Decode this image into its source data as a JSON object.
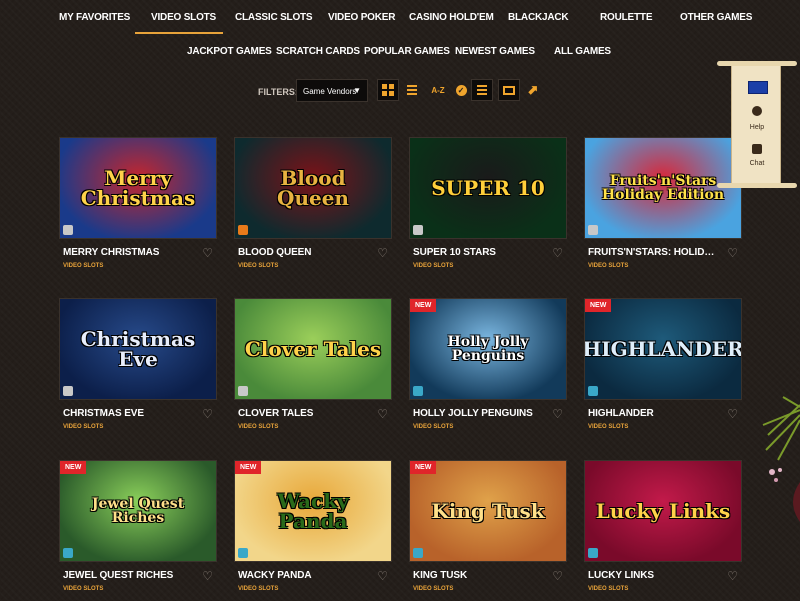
{
  "nav": {
    "main": [
      "MY FAVORITES",
      "VIDEO SLOTS",
      "CLASSIC SLOTS",
      "VIDEO POKER",
      "CASINO HOLD'EM",
      "BLACKJACK",
      "ROULETTE",
      "OTHER GAMES"
    ],
    "active": "VIDEO SLOTS",
    "sub": [
      "JACKPOT GAMES",
      "SCRATCH CARDS",
      "POPULAR GAMES",
      "NEWEST GAMES",
      "ALL GAMES"
    ]
  },
  "filters": {
    "label": "FILTERS:",
    "vendor_select": "Game Vendors",
    "sort_az": "A-Z"
  },
  "side_widget": {
    "help": "Help",
    "chat": "Chat"
  },
  "colors": {
    "accent": "#e8a33a",
    "new_badge": "#e0252a",
    "background": "#241e1a"
  },
  "games": [
    {
      "name": "MERRY CHRISTMAS",
      "category": "VIDEO SLOTS",
      "art": "Merry Christmas",
      "is_new": false
    },
    {
      "name": "BLOOD QUEEN",
      "category": "VIDEO SLOTS",
      "art": "Blood Queen",
      "is_new": false
    },
    {
      "name": "SUPER 10 STARS",
      "category": "VIDEO SLOTS",
      "art": "SUPER 10",
      "is_new": false
    },
    {
      "name": "FRUITS'N'STARS: HOLIDAY E...",
      "category": "VIDEO SLOTS",
      "art": "Fruits'n'Stars Holiday Edition",
      "is_new": false
    },
    {
      "name": "CHRISTMAS EVE",
      "category": "VIDEO SLOTS",
      "art": "Christmas Eve",
      "is_new": false
    },
    {
      "name": "CLOVER TALES",
      "category": "VIDEO SLOTS",
      "art": "Clover Tales",
      "is_new": false
    },
    {
      "name": "HOLLY JOLLY PENGUINS",
      "category": "VIDEO SLOTS",
      "art": "Holly Jolly Penguins",
      "is_new": true
    },
    {
      "name": "HIGHLANDER",
      "category": "VIDEO SLOTS",
      "art": "HIGHLANDER",
      "is_new": true
    },
    {
      "name": "JEWEL QUEST RICHES",
      "category": "VIDEO SLOTS",
      "art": "Jewel Quest Riches",
      "is_new": true
    },
    {
      "name": "WACKY PANDA",
      "category": "VIDEO SLOTS",
      "art": "Wacky Panda",
      "is_new": true
    },
    {
      "name": "KING TUSK",
      "category": "VIDEO SLOTS",
      "art": "King Tusk",
      "is_new": true
    },
    {
      "name": "LUCKY LINKS",
      "category": "VIDEO SLOTS",
      "art": "Lucky Links",
      "is_new": false
    }
  ],
  "new_badge_label": "NEW",
  "tile_icons": [
    "s-icon",
    "star-icon",
    "s-icon",
    "s-icon",
    "s-icon",
    "s-icon",
    "mg-icon",
    "mg-icon",
    "mg-icon",
    "mg-icon",
    "mg-icon",
    "mg-icon"
  ]
}
